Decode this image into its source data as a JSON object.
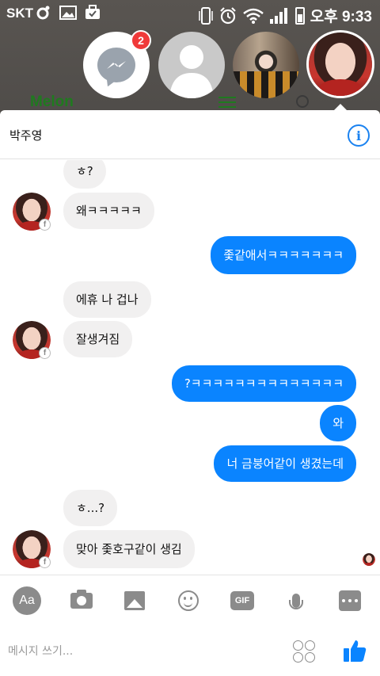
{
  "status_bar": {
    "carrier": "SKT",
    "time": "오후 9:33"
  },
  "chat_heads": {
    "messenger_badge": "2",
    "items": [
      "messenger-head",
      "blank-profile-head",
      "photo-head-1",
      "photo-head-2-active"
    ]
  },
  "backdrop": {
    "app_logo": "Melon"
  },
  "header": {
    "contact_name": "박주영",
    "info_icon": "info-icon"
  },
  "conversation": {
    "messages": [
      {
        "side": "in",
        "text": "ㅎ?"
      },
      {
        "side": "in",
        "text": "왜ㅋㅋㅋㅋㅋ"
      },
      {
        "side": "out",
        "text": "좇같애서ㅋㅋㅋㅋㅋㅋㅋ"
      },
      {
        "side": "in",
        "text": "에휴 나 겁나"
      },
      {
        "side": "in",
        "text": "잘생겨짐"
      },
      {
        "side": "out",
        "text": "?ㅋㅋㅋㅋㅋㅋㅋㅋㅋㅋㅋㅋㅋㅋ"
      },
      {
        "side": "out",
        "text": "와"
      },
      {
        "side": "out",
        "text": "너 금붕어같이 생겼는데"
      },
      {
        "side": "in",
        "text": "ㅎ...?"
      },
      {
        "side": "in",
        "text": "맞아 좇호구같이 생김"
      }
    ]
  },
  "toolbar": {
    "aa_label": "Aa",
    "gif_label": "GIF",
    "icons": [
      "aa-icon",
      "camera-icon",
      "image-icon",
      "emoji-icon",
      "gif-icon",
      "microphone-icon",
      "more-icon"
    ]
  },
  "composer": {
    "placeholder": "메시지 쓰기...",
    "value": ""
  },
  "colors": {
    "accent": "#0a84ff",
    "incoming_bubble": "#f1f0f0",
    "badge": "#f03a3a",
    "icon_gray": "#8b8b8b"
  }
}
